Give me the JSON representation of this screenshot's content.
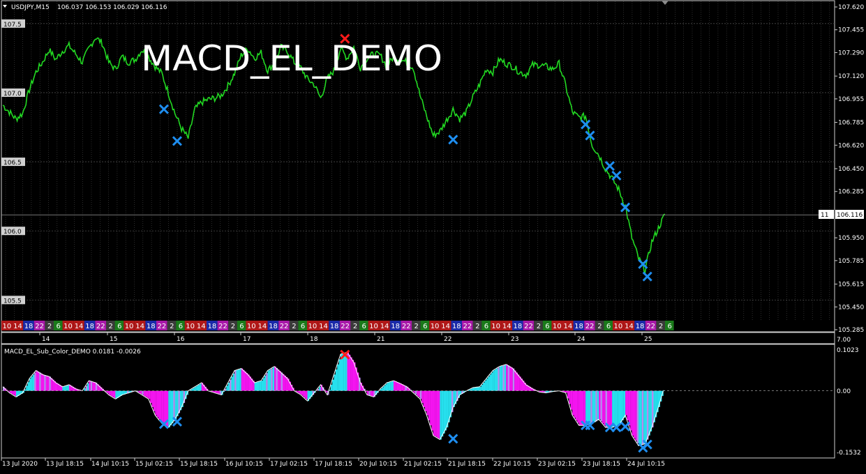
{
  "header": {
    "symbol_label": "USDJPY,M15",
    "ohlc_text": "106.037 106.153 106.029 106.116",
    "overlay_title": "MACD_EL_DEMO"
  },
  "sub_header": {
    "indicator_label": "MACD_EL_Sub_Color_DEMO 0.0181 -0.0026"
  },
  "colors": {
    "price": "#22d822",
    "macd_cyan": "#26e0ee",
    "macd_magenta": "#f414f0",
    "macd_violet": "#b68cf0",
    "buy_mark": "#1e8ef0",
    "sell_mark": "#ff1a1a",
    "grid": "#4a4a4a",
    "price_axis_box": "#ffffff"
  },
  "current_price": "106.116",
  "current_price_tag": "11",
  "price_axis": [
    "107.620",
    "107.455",
    "107.290",
    "107.120",
    "106.955",
    "106.785",
    "106.620",
    "106.450",
    "106.285",
    "106.116",
    "105.950",
    "105.785",
    "105.615",
    "105.450",
    "105.285"
  ],
  "left_levels": [
    "107.5",
    "107.0",
    "106.5",
    "106.0",
    "105.5"
  ],
  "day_labels": [
    "14",
    "15",
    "16",
    "17",
    "18",
    "21",
    "22",
    "23",
    "24",
    "25"
  ],
  "session_strip_pattern": [
    "10",
    "14",
    "18",
    "22",
    "2",
    "6"
  ],
  "sub_axis": {
    "top": "0.1023",
    "zero": "0.00",
    "bottom": "-0.1532",
    "corner": "7.00"
  },
  "time_axis": [
    "13 Jul 2020",
    "13 Jul 18:15",
    "14 Jul 10:15",
    "15 Jul 02:15",
    "15 Jul 18:15",
    "16 Jul 10:15",
    "17 Jul 02:15",
    "17 Jul 18:15",
    "20 Jul 10:15",
    "21 Jul 02:15",
    "21 Jul 18:15",
    "22 Jul 10:15",
    "23 Jul 02:15",
    "23 Jul 18:15",
    "24 Jul 10:15"
  ],
  "chart_data": [
    {
      "type": "line",
      "series": [
        {
          "name": "USDJPY,M15",
          "x": [
            0,
            3,
            6,
            9,
            12,
            15,
            18,
            21,
            24,
            27,
            30,
            33,
            36,
            39,
            42,
            45,
            48,
            51,
            54,
            57,
            60,
            63,
            66,
            69,
            72,
            75,
            78,
            81,
            84,
            87,
            90,
            93,
            96,
            99,
            102,
            105,
            108,
            111,
            114,
            117,
            120,
            123,
            126,
            129,
            132,
            135,
            138,
            141,
            144,
            147,
            150,
            153,
            156,
            159,
            162,
            165,
            168,
            171,
            174,
            177,
            180,
            183,
            186,
            189,
            192,
            195,
            198,
            201,
            204,
            207,
            210,
            213,
            216,
            219,
            222,
            225,
            228,
            231,
            234,
            237,
            240,
            243,
            246,
            249,
            252,
            255,
            258,
            261,
            264,
            267,
            270,
            273,
            276,
            279,
            282,
            285,
            288,
            291,
            294,
            297,
            300
          ],
          "values": [
            106.91,
            106.86,
            106.81,
            106.85,
            107.02,
            107.15,
            107.22,
            107.31,
            107.24,
            107.3,
            107.34,
            107.28,
            107.22,
            107.32,
            107.4,
            107.36,
            107.22,
            107.17,
            107.26,
            107.22,
            107.24,
            107.31,
            107.26,
            107.19,
            107.14,
            107.0,
            106.85,
            106.74,
            106.67,
            106.88,
            106.93,
            106.95,
            106.96,
            106.98,
            107.05,
            107.14,
            107.27,
            107.32,
            107.25,
            107.29,
            107.16,
            107.21,
            107.33,
            107.3,
            107.22,
            107.18,
            107.1,
            107.06,
            106.96,
            107.1,
            107.16,
            107.32,
            107.25,
            107.33,
            107.18,
            107.25,
            107.28,
            107.27,
            107.19,
            107.26,
            107.24,
            107.22,
            107.18,
            106.98,
            106.83,
            106.69,
            106.72,
            106.8,
            106.88,
            106.81,
            106.86,
            106.97,
            107.06,
            107.17,
            107.15,
            107.24,
            107.21,
            107.19,
            107.15,
            107.13,
            107.2,
            107.2,
            107.19,
            107.17,
            107.21,
            107.05,
            106.86,
            106.82,
            106.83,
            106.62,
            106.55,
            106.45,
            106.38,
            106.3,
            106.18,
            105.95,
            105.8,
            105.72,
            105.92,
            106.02,
            106.12
          ]
        }
      ],
      "ylim": [
        105.285,
        107.62
      ],
      "x_tick_labels": [
        "14",
        "15",
        "16",
        "17",
        "18",
        "21",
        "22",
        "23",
        "24",
        "25"
      ],
      "markers": [
        {
          "kind": "buy",
          "x": 73,
          "y": 106.88
        },
        {
          "kind": "buy",
          "x": 79,
          "y": 106.65
        },
        {
          "kind": "sell",
          "x": 155,
          "y": 107.39
        },
        {
          "kind": "buy",
          "x": 204,
          "y": 106.66
        },
        {
          "kind": "buy",
          "x": 264,
          "y": 106.77
        },
        {
          "kind": "buy",
          "x": 266,
          "y": 106.69
        },
        {
          "kind": "buy",
          "x": 275,
          "y": 106.47
        },
        {
          "kind": "buy",
          "x": 278,
          "y": 106.4
        },
        {
          "kind": "buy",
          "x": 282,
          "y": 106.17
        },
        {
          "kind": "buy",
          "x": 290,
          "y": 105.76
        },
        {
          "kind": "buy",
          "x": 292,
          "y": 105.67
        }
      ]
    },
    {
      "type": "area",
      "series": [
        {
          "name": "MACD_EL_Sub_Color_DEMO",
          "x": [
            0,
            3,
            6,
            9,
            12,
            15,
            18,
            21,
            24,
            27,
            30,
            33,
            36,
            39,
            42,
            45,
            48,
            51,
            54,
            57,
            60,
            63,
            66,
            69,
            72,
            75,
            78,
            81,
            84,
            87,
            90,
            93,
            96,
            99,
            102,
            105,
            108,
            111,
            114,
            117,
            120,
            123,
            126,
            129,
            132,
            135,
            138,
            141,
            144,
            147,
            150,
            153,
            156,
            159,
            162,
            165,
            168,
            171,
            174,
            177,
            180,
            183,
            186,
            189,
            192,
            195,
            198,
            201,
            204,
            207,
            210,
            213,
            216,
            219,
            222,
            225,
            228,
            231,
            234,
            237,
            240,
            243,
            246,
            249,
            252,
            255,
            258,
            261,
            264,
            267,
            270,
            273,
            276,
            279,
            282,
            285,
            288,
            291,
            294,
            297,
            300
          ],
          "values": [
            0.01,
            -0.005,
            -0.015,
            -0.005,
            0.03,
            0.05,
            0.04,
            0.035,
            0.02,
            0.01,
            0.015,
            0.005,
            0.0,
            0.025,
            0.02,
            0.005,
            -0.01,
            -0.02,
            -0.01,
            -0.005,
            0.0,
            -0.01,
            -0.02,
            -0.06,
            -0.08,
            -0.09,
            -0.07,
            -0.04,
            0.0,
            0.01,
            0.02,
            0.0,
            -0.005,
            -0.01,
            0.02,
            0.05,
            0.055,
            0.04,
            0.02,
            0.025,
            0.05,
            0.06,
            0.045,
            0.03,
            0.0,
            -0.01,
            -0.025,
            -0.005,
            0.015,
            -0.01,
            0.04,
            0.09,
            0.095,
            0.07,
            0.02,
            -0.01,
            -0.015,
            0.005,
            0.02,
            0.025,
            0.018,
            0.01,
            -0.005,
            -0.02,
            -0.06,
            -0.11,
            -0.12,
            -0.09,
            -0.04,
            -0.01,
            0.0,
            0.008,
            0.01,
            0.03,
            0.05,
            0.06,
            0.065,
            0.055,
            0.035,
            0.015,
            0.005,
            -0.003,
            -0.005,
            -0.002,
            0.0,
            -0.005,
            -0.06,
            -0.085,
            -0.085,
            -0.08,
            -0.07,
            -0.09,
            -0.09,
            -0.085,
            -0.06,
            -0.11,
            -0.135,
            -0.13,
            -0.09,
            -0.04,
            0.015
          ]
        }
      ],
      "ylim": [
        -0.1532,
        0.1023
      ],
      "zero_line": 0.0,
      "markers": [
        {
          "kind": "buy",
          "x": 73,
          "y": -0.082
        },
        {
          "kind": "buy",
          "x": 79,
          "y": -0.076
        },
        {
          "kind": "sell",
          "x": 155,
          "y": 0.089
        },
        {
          "kind": "buy",
          "x": 204,
          "y": -0.118
        },
        {
          "kind": "buy",
          "x": 264,
          "y": -0.085
        },
        {
          "kind": "buy",
          "x": 266,
          "y": -0.085
        },
        {
          "kind": "buy",
          "x": 275,
          "y": -0.09
        },
        {
          "kind": "buy",
          "x": 278,
          "y": -0.09
        },
        {
          "kind": "buy",
          "x": 282,
          "y": -0.088
        },
        {
          "kind": "buy",
          "x": 290,
          "y": -0.14
        },
        {
          "kind": "buy",
          "x": 292,
          "y": -0.132
        }
      ]
    }
  ]
}
